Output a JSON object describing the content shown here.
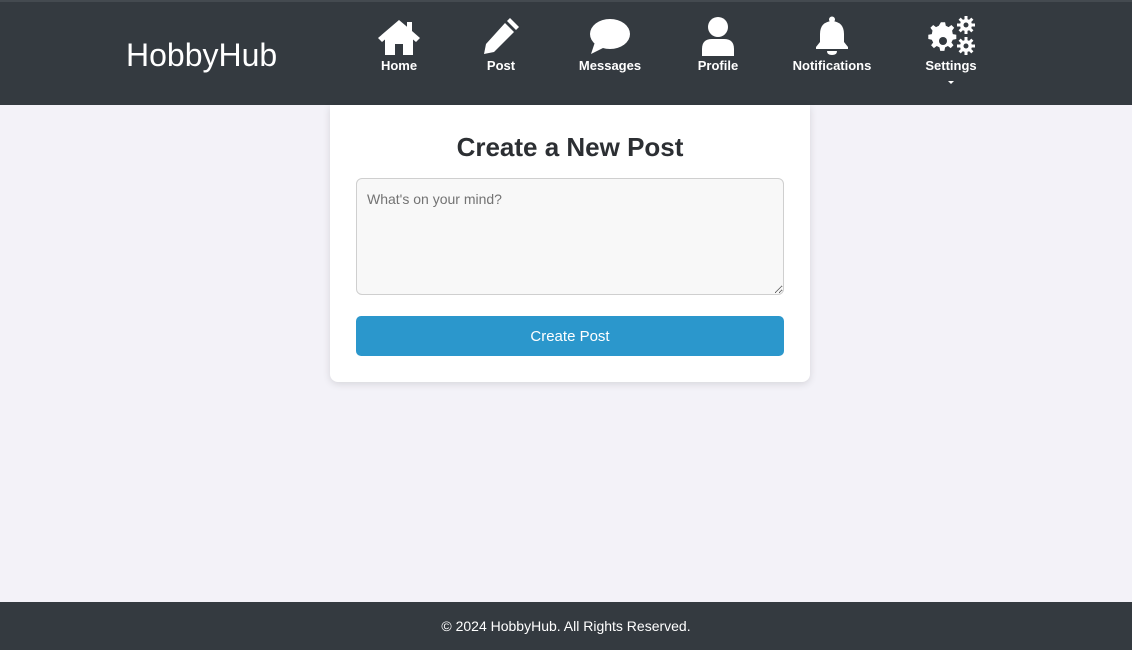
{
  "header": {
    "logo": "HobbyHub",
    "nav": [
      {
        "label": "Home",
        "icon": "home-icon"
      },
      {
        "label": "Post",
        "icon": "pencil-icon"
      },
      {
        "label": "Messages",
        "icon": "chat-bubble-icon"
      },
      {
        "label": "Profile",
        "icon": "user-icon"
      },
      {
        "label": "Notifications",
        "icon": "bell-icon"
      },
      {
        "label": "Settings",
        "icon": "gears-icon",
        "has_dropdown": true
      }
    ],
    "background": "#343a40"
  },
  "main": {
    "title": "Create a New Post",
    "textarea": {
      "placeholder": "What's on your mind?",
      "value": ""
    },
    "submit_label": "Create Post",
    "accent": "#2b97cc"
  },
  "footer": {
    "text": "© 2024 HobbyHub. All Rights Reserved."
  }
}
